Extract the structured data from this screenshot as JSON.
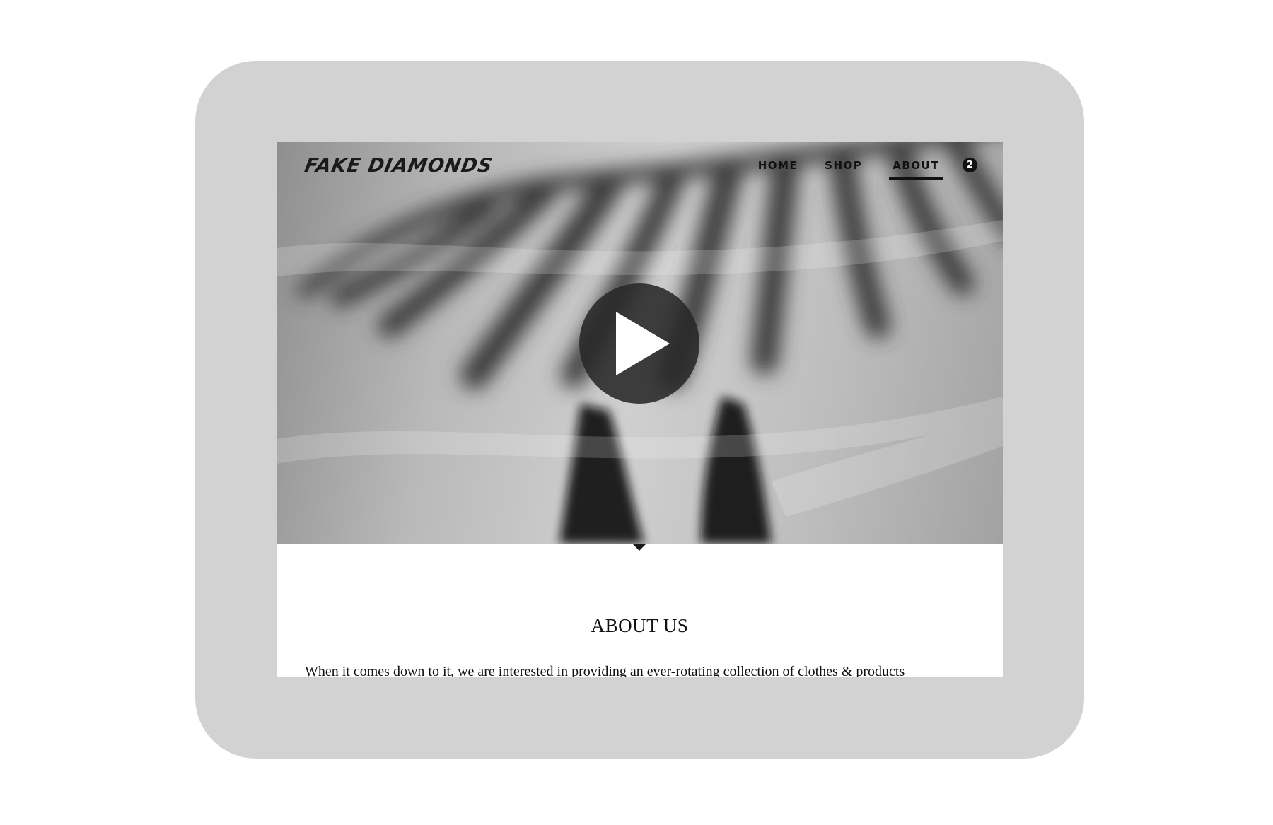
{
  "site": {
    "logo_text": "FAKE DIAMONDS"
  },
  "nav": {
    "items": [
      {
        "label": "HOME"
      },
      {
        "label": "SHOP"
      },
      {
        "label": "ABOUT"
      }
    ],
    "active": "ABOUT",
    "cart_count": "2"
  },
  "hero": {
    "media": "video",
    "play_icon": "play-icon"
  },
  "about": {
    "heading": "ABOUT US",
    "body": "When it comes down to it, we are interested in providing an ever-rotating collection of clothes & products"
  },
  "colors": {
    "device_frame": "#d2d2d2",
    "text": "#111111",
    "play_button": "#282828"
  }
}
